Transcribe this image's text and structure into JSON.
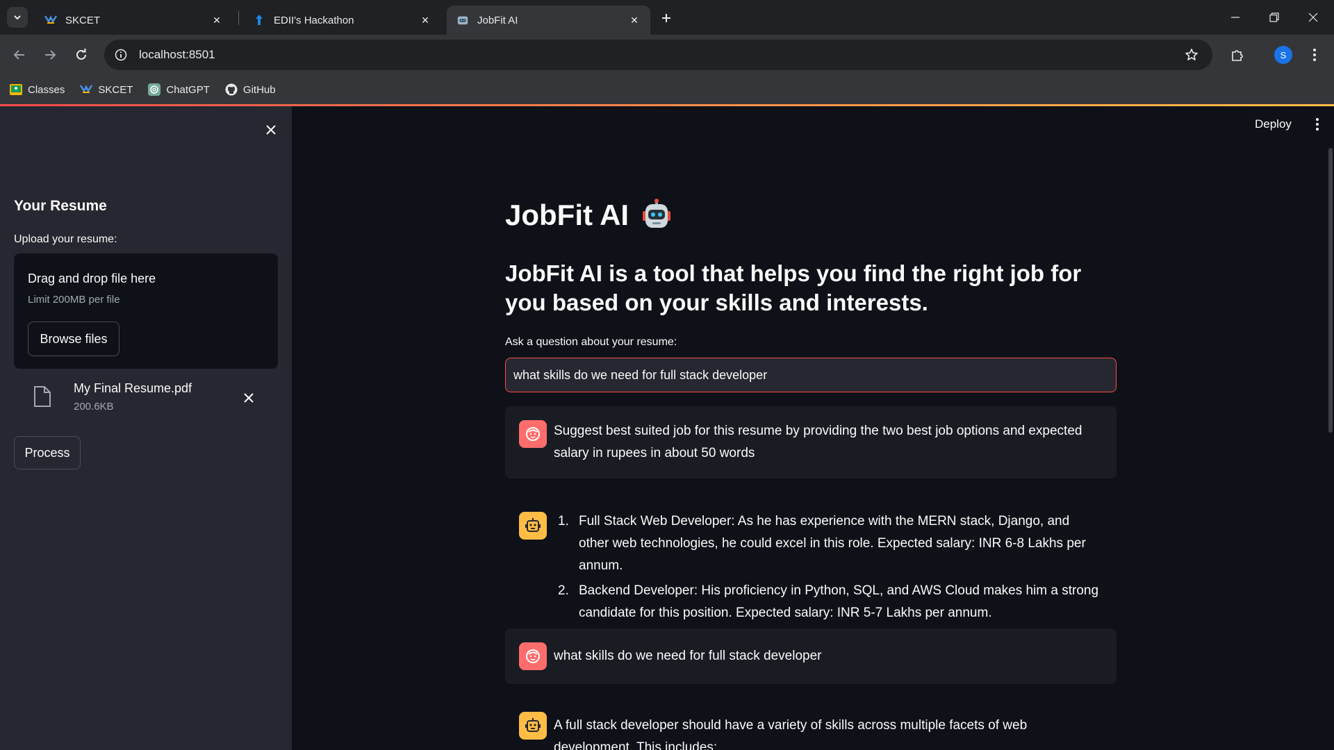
{
  "browser": {
    "tabs": [
      {
        "title": "SKCET",
        "active": false
      },
      {
        "title": "EDII's Hackathon",
        "active": false
      },
      {
        "title": "JobFit AI",
        "active": true
      }
    ],
    "url": "localhost:8501",
    "profile_initial": "S",
    "bookmarks": [
      {
        "label": "Classes",
        "icon": "classroom-icon"
      },
      {
        "label": "SKCET",
        "icon": "skcet-logo-icon"
      },
      {
        "label": "ChatGPT",
        "icon": "chatgpt-icon"
      },
      {
        "label": "GitHub",
        "icon": "github-icon"
      }
    ]
  },
  "sidebar": {
    "heading": "Your Resume",
    "upload_label": "Upload your resume:",
    "dropzone": {
      "title": "Drag and drop file here",
      "limit": "Limit 200MB per file",
      "browse_label": "Browse files"
    },
    "file": {
      "name": "My Final Resume.pdf",
      "size": "200.6KB"
    },
    "process_label": "Process"
  },
  "header": {
    "deploy_label": "Deploy"
  },
  "main": {
    "title": "JobFit AI",
    "subtitle": "JobFit AI is a tool that helps you find the right job for you based on your skills and interests.",
    "question_label": "Ask a question about your resume:",
    "question_value": "what skills do we need for full stack developer",
    "messages": [
      {
        "role": "user",
        "text": "Suggest best suited job for this resume by providing the two best job options and expected salary in rupees in about 50 words"
      },
      {
        "role": "assistant",
        "items": [
          {
            "num": "1.",
            "text": "Full Stack Web Developer: As he has experience with the MERN stack, Django, and other web technologies, he could excel in this role. Expected salary: INR 6-8 Lakhs per annum."
          },
          {
            "num": "2.",
            "text": "Backend Developer: His proficiency in Python, SQL, and AWS Cloud makes him a strong candidate for this position. Expected salary: INR 5-7 Lakhs per annum."
          }
        ]
      },
      {
        "role": "user",
        "text": "what skills do we need for full stack developer"
      },
      {
        "role": "assistant",
        "text": "A full stack developer should have a variety of skills across multiple facets of web development. This includes:"
      }
    ]
  },
  "colors": {
    "accent": "#ff4b4b",
    "user_avatar": "#ff6c6c",
    "assistant_avatar": "#ffbd45",
    "sidebar_bg": "#262730",
    "main_bg": "#0e1117"
  }
}
